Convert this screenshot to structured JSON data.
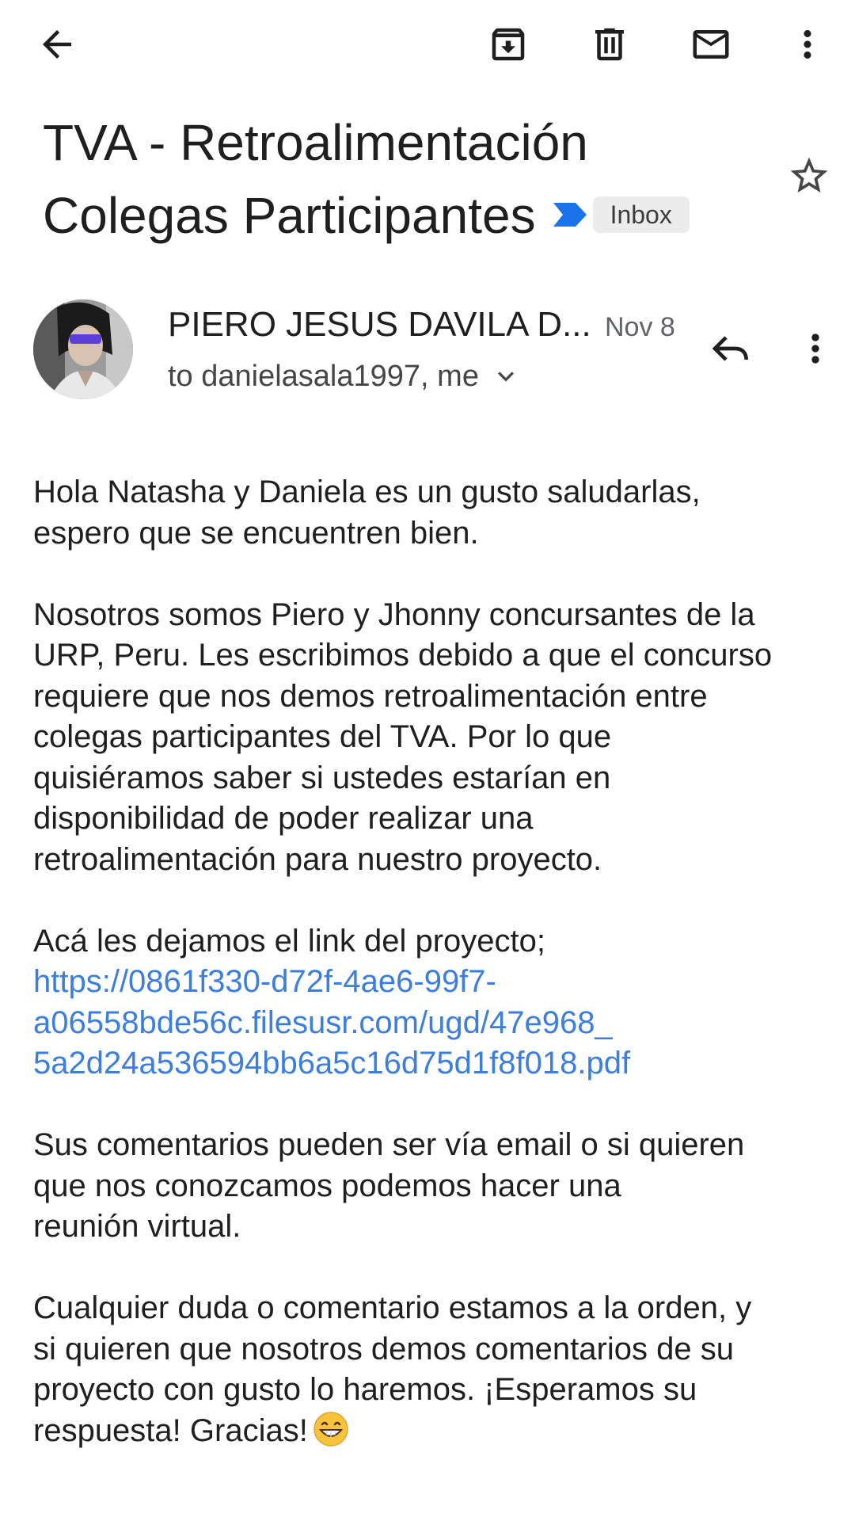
{
  "toolbar": {
    "back_icon": "arrow-back-icon",
    "archive_icon": "archive-icon",
    "delete_icon": "trash-icon",
    "mark_unread_icon": "mail-icon",
    "more_icon": "more-vert-icon"
  },
  "subject": {
    "line1": "TVA - Retroalimentación",
    "line2": "Colegas Participantes",
    "important_icon": "important-marker-icon",
    "important_color": "#1a73e8",
    "label": "Inbox",
    "starred": false
  },
  "message": {
    "sender_name": "PIERO JESUS DAVILA D...",
    "date": "Nov 8",
    "recipients": "to danielasala1997, me",
    "reply_icon": "reply-icon",
    "more_icon": "more-vert-icon"
  },
  "body": {
    "p1": "Hola Natasha y Daniela es un gusto saludarlas,\nespero que se encuentren bien.",
    "p2": "Nosotros somos Piero y Jhonny concursantes de la\nURP, Peru. Les escribimos debido a que el concurso\nrequiere que nos demos retroalimentación entre\ncolegas participantes del TVA. Por lo que\nquisiéramos saber si ustedes estarían en\ndisponibilidad de poder realizar una\nretroalimentación para nuestro proyecto.",
    "p3": "Acá les dejamos el link del proyecto;",
    "link": "https://0861f330-d72f-4ae6-99f7-\na06558bde56c.filesusr.com/ugd/47e968_\n5a2d24a536594bb6a5c16d75d1f8f018.pdf",
    "p4": "Sus comentarios pueden ser vía email o si quieren\nque nos conozcamos podemos hacer una\nreunión virtual.",
    "p5": "Cualquier duda o comentario estamos a la orden, y\nsi quieren que nosotros demos comentarios de su\nproyecto con gusto lo haremos. ¡Esperamos su\nrespuesta! Gracias!",
    "emoji_icon": "grinning-face-emoji-icon",
    "link_color": "#3b7ee0"
  }
}
